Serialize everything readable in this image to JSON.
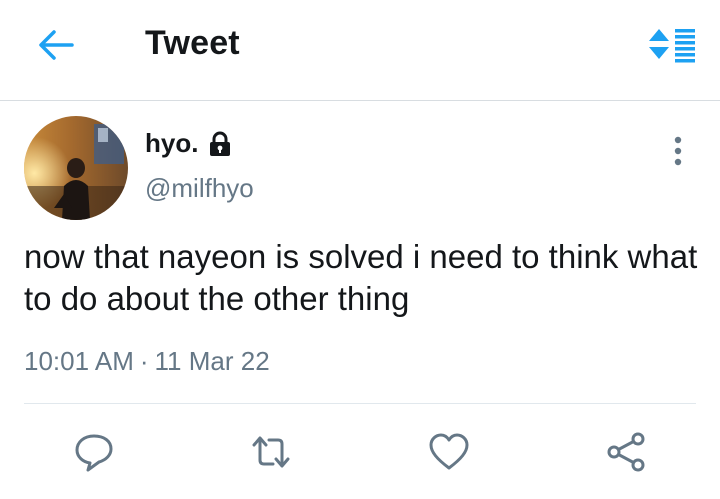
{
  "header": {
    "title": "Tweet",
    "back_icon": "arrow-left-icon",
    "sort_icon": "sort-order-icon"
  },
  "tweet": {
    "display_name": "hyo.",
    "handle": "@milfhyo",
    "lock_icon": "lock-icon",
    "text": "now that nayeon is solved i need to think what to do about the other thing",
    "time": "10:01 AM",
    "separator": "·",
    "date": "11 Mar 22"
  },
  "actions": [
    "reply-icon",
    "retweet-icon",
    "like-icon",
    "share-icon"
  ],
  "colors": {
    "accent": "#1da1f2",
    "icon_gray": "#657786",
    "text": "#14171a",
    "divider": "#e1e8ed"
  }
}
